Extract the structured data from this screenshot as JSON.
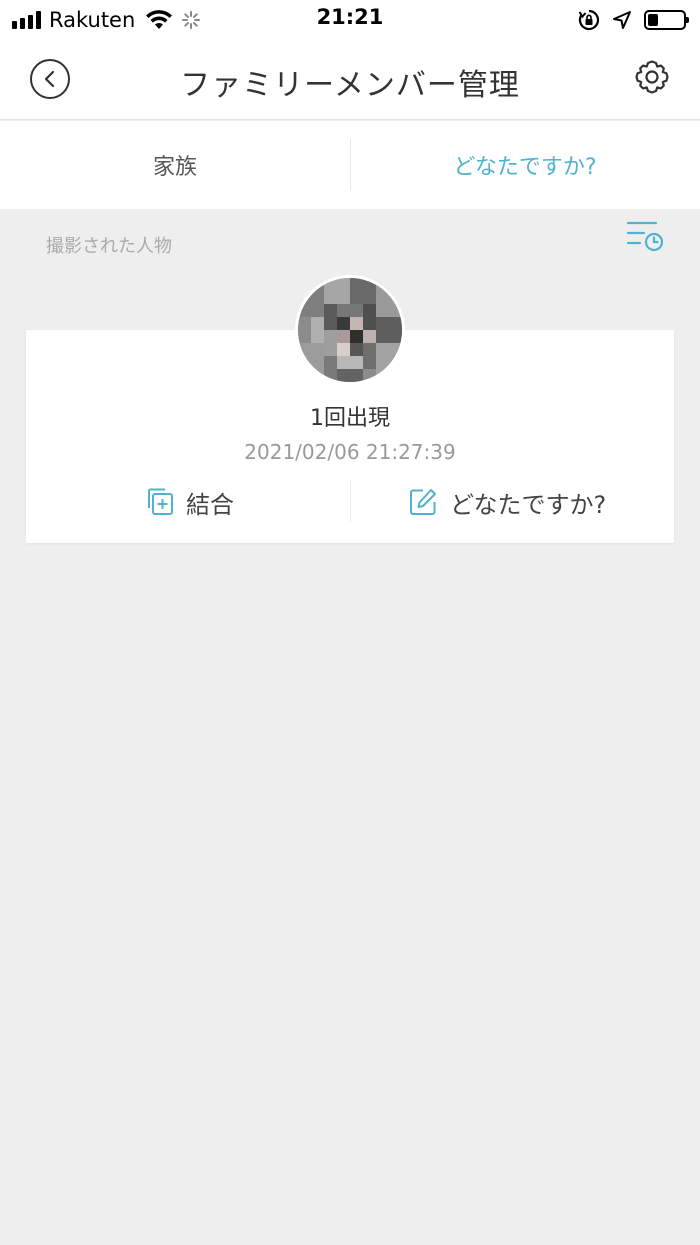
{
  "status_bar": {
    "carrier": "Rakuten",
    "time": "21:21"
  },
  "header": {
    "title": "ファミリーメンバー管理"
  },
  "tabs": [
    {
      "label": "家族",
      "active": false
    },
    {
      "label": "どなたですか?",
      "active": true
    }
  ],
  "section": {
    "label": "撮影された人物"
  },
  "card": {
    "appear_count": "1回出現",
    "timestamp": "2021/02/06 21:27:39",
    "actions": {
      "merge_label": "結合",
      "identify_label": "どなたですか?"
    }
  },
  "colors": {
    "accent": "#4fb3cf",
    "background": "#eeeeee",
    "card": "#ffffff",
    "text_primary": "#333333",
    "text_secondary": "#999999"
  },
  "icons": {
    "back": "chevron-left-icon",
    "settings": "gear-icon",
    "sort": "list-clock-icon",
    "merge": "merge-icon",
    "edit": "edit-icon"
  }
}
